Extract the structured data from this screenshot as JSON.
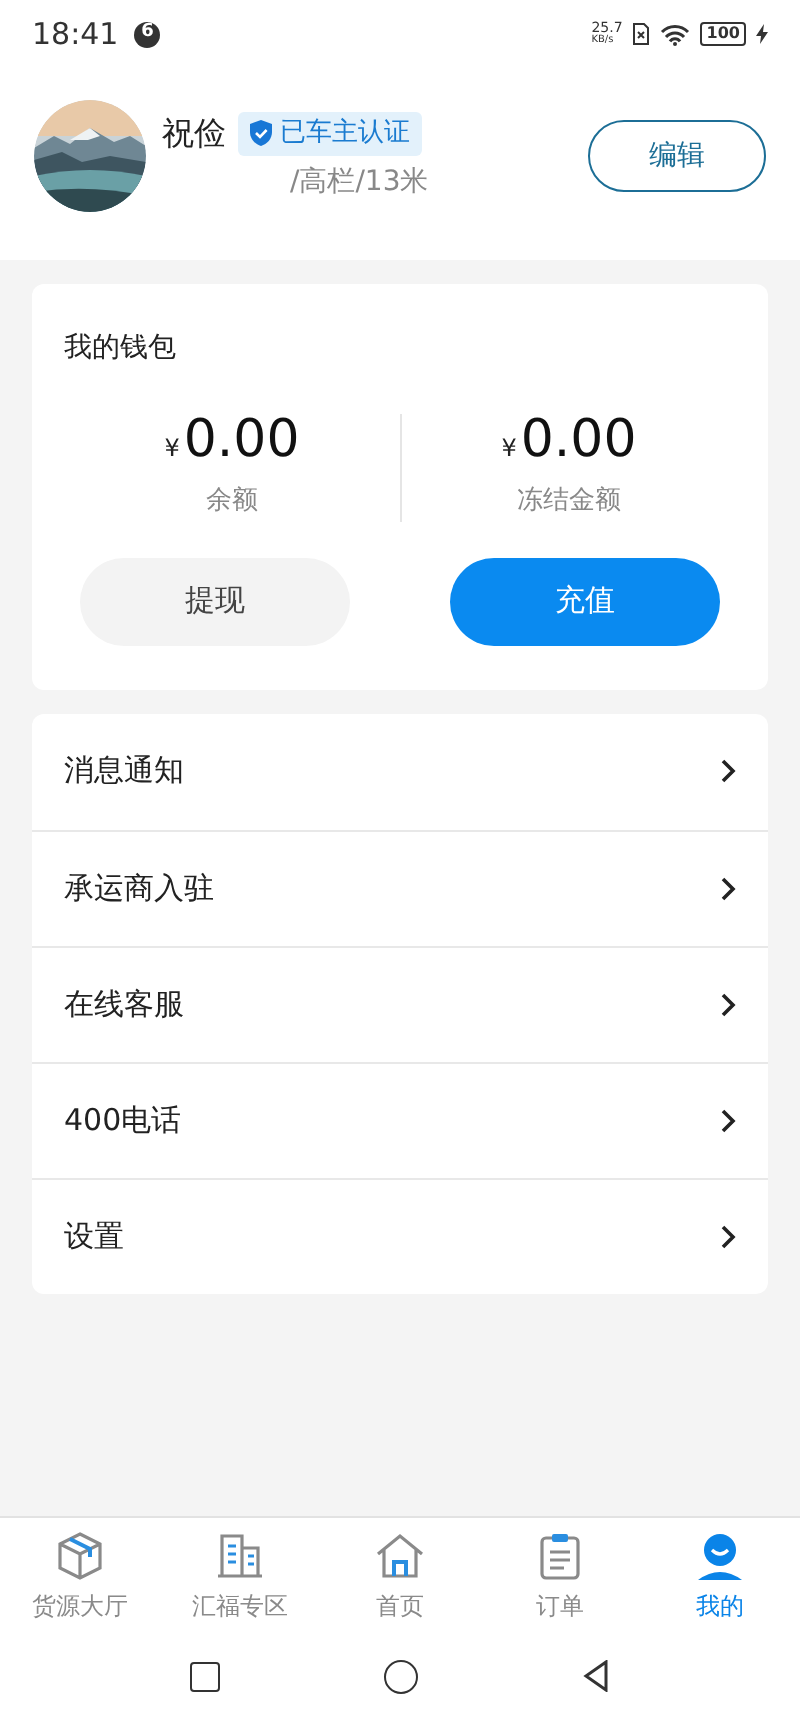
{
  "status_bar": {
    "time": "18:41",
    "notification_count": "6",
    "net_speed_value": "25.7",
    "net_speed_unit": "KB/s",
    "battery": "100"
  },
  "profile": {
    "name": "祝俭",
    "badge": "已车主认证",
    "vehicle": "/高栏/13米",
    "edit_button": "编辑"
  },
  "wallet": {
    "title": "我的钱包",
    "balances": [
      {
        "currency": "¥",
        "amount": "0.00",
        "label": "余额"
      },
      {
        "currency": "¥",
        "amount": "0.00",
        "label": "冻结金额"
      }
    ],
    "buttons": [
      {
        "label": "提现",
        "kind": "secondary"
      },
      {
        "label": "充值",
        "kind": "primary"
      }
    ]
  },
  "menu": [
    {
      "label": "消息通知"
    },
    {
      "label": "承运商入驻"
    },
    {
      "label": "在线客服"
    },
    {
      "label": "400电话"
    },
    {
      "label": "设置"
    }
  ],
  "tab_bar": [
    {
      "label": "货源大厅",
      "selected": false
    },
    {
      "label": "汇福专区",
      "selected": false
    },
    {
      "label": "首页",
      "selected": false
    },
    {
      "label": "订单",
      "selected": false
    },
    {
      "label": "我的",
      "selected": true
    }
  ]
}
